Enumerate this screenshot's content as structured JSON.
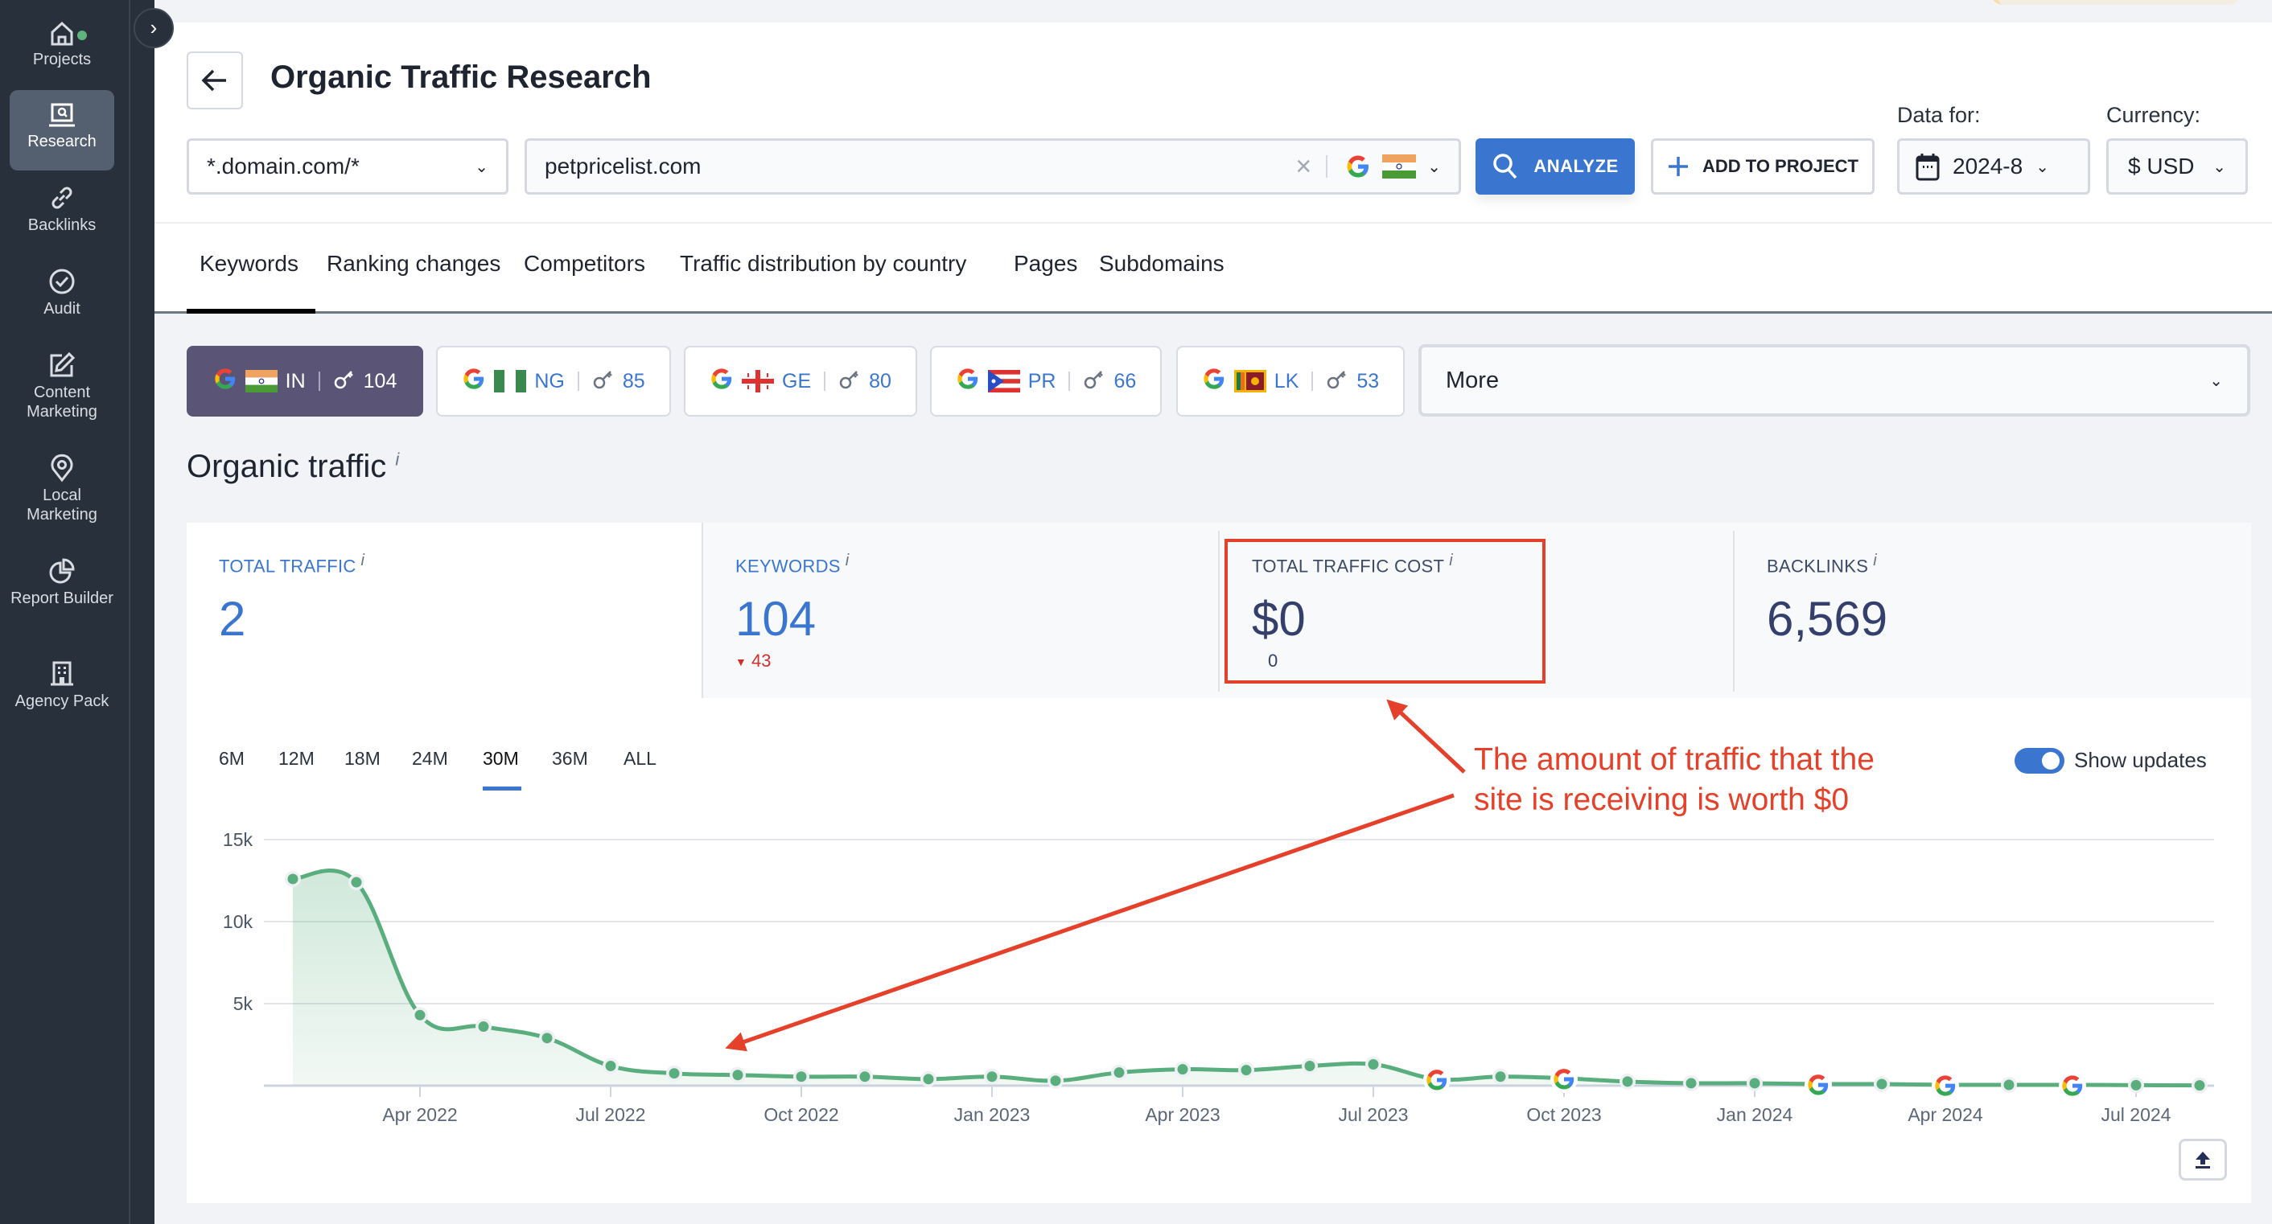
{
  "sidebar": {
    "items": [
      {
        "label": "Projects",
        "icon": "home-icon"
      },
      {
        "label": "Research",
        "icon": "research-icon",
        "active": true
      },
      {
        "label": "Backlinks",
        "icon": "link-icon"
      },
      {
        "label": "Audit",
        "icon": "check-circle-icon"
      },
      {
        "label": "Content Marketing",
        "icon": "edit-icon"
      },
      {
        "label": "Local Marketing",
        "icon": "location-pin-icon"
      },
      {
        "label": "Report Builder",
        "icon": "pie-chart-icon"
      },
      {
        "label": "Agency Pack",
        "icon": "building-icon"
      }
    ]
  },
  "header": {
    "title": "Organic Traffic Research",
    "scope_select": "*.domain.com/*",
    "domain_input": "petpricelist.com",
    "search_engine": "Google",
    "country_flag": "India",
    "analyze_label": "ANALYZE",
    "add_project_label": "ADD TO PROJECT",
    "data_for_label": "Data for:",
    "data_for_value": "2024-8",
    "currency_label": "Currency:",
    "currency_value": "$ USD"
  },
  "tabs": [
    {
      "label": "Keywords",
      "active": true
    },
    {
      "label": "Ranking changes"
    },
    {
      "label": "Competitors"
    },
    {
      "label": "Traffic distribution by country"
    },
    {
      "label": "Pages"
    },
    {
      "label": "Subdomains"
    }
  ],
  "country_chips": [
    {
      "code": "IN",
      "keywords": "104",
      "active": true
    },
    {
      "code": "NG",
      "keywords": "85"
    },
    {
      "code": "GE",
      "keywords": "80"
    },
    {
      "code": "PR",
      "keywords": "66"
    },
    {
      "code": "LK",
      "keywords": "53"
    }
  ],
  "more_label": "More",
  "section_title": "Organic traffic",
  "info_glyph": "i",
  "metrics": [
    {
      "label": "TOTAL TRAFFIC",
      "value": "2"
    },
    {
      "label": "KEYWORDS",
      "value": "104",
      "delta": "43",
      "delta_direction": "down"
    },
    {
      "label": "TOTAL TRAFFIC COST",
      "value": "$0",
      "sub": "0"
    },
    {
      "label": "BACKLINKS",
      "value": "6,569"
    }
  ],
  "periods": [
    "6M",
    "12M",
    "18M",
    "24M",
    "30M",
    "36M",
    "ALL"
  ],
  "active_period": "30M",
  "show_updates_label": "Show updates",
  "show_updates_on": true,
  "annotation": {
    "line1": "The amount of traffic that the",
    "line2": "site is receiving is worth $0",
    "color": "#e5402a"
  },
  "colors": {
    "accent": "#3a76cf",
    "line": "#5aae7e",
    "sidebar": "#27303b",
    "active_chip": "#5a5577",
    "negative": "#d0302c"
  },
  "chart_data": {
    "type": "area",
    "title": "Organic traffic",
    "xlabel": "",
    "ylabel": "",
    "ylim": [
      0,
      15000
    ],
    "yticks": [
      {
        "v": 5000,
        "label": "5k"
      },
      {
        "v": 10000,
        "label": "10k"
      },
      {
        "v": 15000,
        "label": "15k"
      }
    ],
    "grid": true,
    "x": [
      "2022-02",
      "2022-03",
      "2022-04",
      "2022-05",
      "2022-06",
      "2022-07",
      "2022-08",
      "2022-09",
      "2022-10",
      "2022-11",
      "2022-12",
      "2023-01",
      "2023-02",
      "2023-03",
      "2023-04",
      "2023-05",
      "2023-06",
      "2023-07",
      "2023-08",
      "2023-09",
      "2023-10",
      "2023-11",
      "2023-12",
      "2024-01",
      "2024-02",
      "2024-03",
      "2024-04",
      "2024-05",
      "2024-06",
      "2024-07",
      "2024-08"
    ],
    "xticks": [
      {
        "index": 2,
        "label": "Apr 2022"
      },
      {
        "index": 5,
        "label": "Jul 2022"
      },
      {
        "index": 8,
        "label": "Oct 2022"
      },
      {
        "index": 11,
        "label": "Jan 2023"
      },
      {
        "index": 14,
        "label": "Apr 2023"
      },
      {
        "index": 17,
        "label": "Jul 2023"
      },
      {
        "index": 20,
        "label": "Oct 2023"
      },
      {
        "index": 23,
        "label": "Jan 2024"
      },
      {
        "index": 26,
        "label": "Apr 2024"
      },
      {
        "index": 29,
        "label": "Jul 2024"
      }
    ],
    "series": [
      {
        "name": "Total traffic",
        "values": [
          12600,
          12400,
          4300,
          3600,
          2900,
          1200,
          750,
          650,
          550,
          550,
          400,
          550,
          300,
          800,
          1000,
          950,
          1200,
          1300,
          400,
          550,
          450,
          250,
          150,
          150,
          100,
          100,
          50,
          50,
          50,
          30,
          20
        ]
      }
    ],
    "google_update_indices": [
      18,
      20,
      24,
      26,
      28
    ]
  }
}
